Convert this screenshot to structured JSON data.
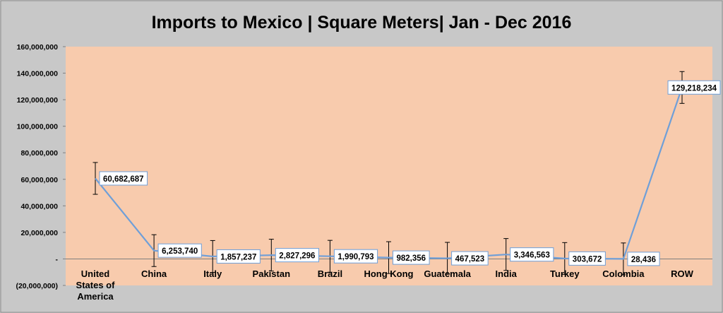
{
  "chart_data": {
    "type": "line",
    "title": "Imports to Mexico | Square Meters| Jan - Dec 2016",
    "xlabel": "",
    "ylabel": "",
    "categories": [
      [
        "United",
        "States of",
        "America"
      ],
      [
        "China"
      ],
      [
        "Italy"
      ],
      [
        "Pakistan"
      ],
      [
        "Brazil"
      ],
      [
        "Hong Kong"
      ],
      [
        "Guatemala"
      ],
      [
        "India"
      ],
      [
        "Turkey"
      ],
      [
        "Colombia"
      ],
      [
        "ROW"
      ]
    ],
    "values": [
      60682687,
      6253740,
      1857237,
      2827296,
      1990793,
      982356,
      467523,
      3346563,
      303672,
      28436,
      129218234
    ],
    "data_labels": [
      "60,682,687",
      "6,253,740",
      "1,857,237",
      "2,827,296",
      "1,990,793",
      "982,356",
      "467,523",
      "3,346,563",
      "303,672",
      "28,436",
      "129,218,234"
    ],
    "error_bars": {
      "type": "fixed",
      "amount": 12000000
    },
    "ylim": [
      -20000000,
      160000000
    ],
    "yticks": [
      -20000000,
      0,
      20000000,
      40000000,
      60000000,
      80000000,
      100000000,
      120000000,
      140000000,
      160000000
    ],
    "ytick_labels": [
      "(20,000,000)",
      "-",
      "20,000,000",
      "40,000,000",
      "60,000,000",
      "80,000,000",
      "100,000,000",
      "120,000,000",
      "140,000,000",
      "160,000,000"
    ],
    "grid": false,
    "legend": "none",
    "colors": {
      "page_background": "#c8c8c8",
      "plot_background": "#f8cbad",
      "line": "#6f9fd8",
      "axis": "#7f7f7f",
      "label_border": "#6f9fd8",
      "label_fill": "#ffffff"
    }
  }
}
